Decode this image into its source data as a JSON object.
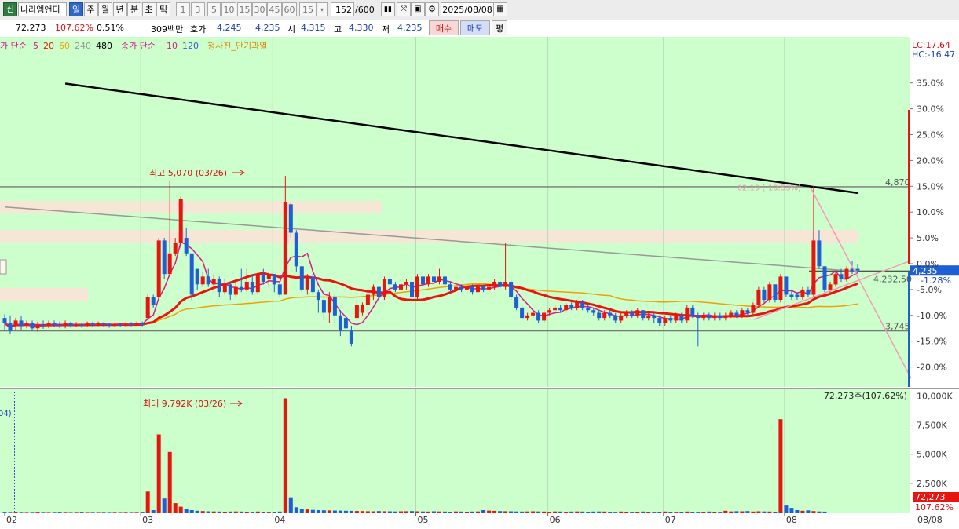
{
  "toolbar": {
    "market_badge": "신",
    "stock_name": "나라엠앤디",
    "periods": [
      "일",
      "주",
      "월",
      "년",
      "분",
      "초",
      "틱"
    ],
    "active_period": "일",
    "intervals": [
      "1",
      "3",
      "5",
      "10",
      "15",
      "30",
      "45",
      "60"
    ],
    "interval_value": "15",
    "count_value": "152",
    "count_total": "/600",
    "date": "2025/08/08"
  },
  "quote": {
    "volume": "72,273",
    "volume_ratio": "107.62%",
    "turnover": "0.51%",
    "amount": "309백만",
    "ask_label": "호가",
    "ask": "4,245",
    "bid": "4,235",
    "open_label": "시",
    "open": "4,315",
    "high_label": "고",
    "high": "4,330",
    "low_label": "저",
    "low": "4,235",
    "buy_label": "매수",
    "sell_label": "매도",
    "eval_label": "평"
  },
  "legend": {
    "ma_prefix": "가 단순",
    "ma_periods": [
      "5",
      "20",
      "60",
      "240",
      "480"
    ],
    "ma_colors": [
      "#d81b8a",
      "#e8140e",
      "#f0a000",
      "#999999",
      "#000000"
    ],
    "vol_ma": "종가 단순",
    "vol_periods": [
      "10",
      "120"
    ],
    "vol_colors": [
      "#d81b8a",
      "#3a5fd0"
    ],
    "signal": "청사진_단기과열",
    "signal_color": "#d98a00"
  },
  "right_top": {
    "lc": "LC:17.64",
    "hc": "HC:-16.47"
  },
  "price_annotations": {
    "max_label": "최고 5,070 (03/26)",
    "level_high": "4,870",
    "level_mid": "4,232,50",
    "level_low": "3,745",
    "current": "4,235",
    "current_pct": "-1.28%",
    "trend_note": "-62.19 (-10.53%)"
  },
  "volume_annotations": {
    "max_label": "최대 9,792K (03/26)",
    "total": "72,273주(107.62%)",
    "current": "72,273",
    "current_pct": "107.62%",
    "left_clip": "04)"
  },
  "chart_data": [
    {
      "type": "candlestick",
      "x": [
        "02",
        "03",
        "04",
        "05",
        "06",
        "07",
        "08"
      ],
      "yaxis_ticks": [
        "35.0%",
        "30.0%",
        "25.0%",
        "20.0%",
        "15.0%",
        "10.0%",
        "5.0%",
        "0.0%",
        "-5.0%",
        "-10.0%",
        "-15.0%",
        "-20.0%"
      ],
      "ylim": [
        -22,
        38
      ],
      "candles": [
        [
          -10.5,
          -11.5,
          -9.8,
          -13.0
        ],
        [
          -11.5,
          -13.0,
          -10.0,
          -13.5
        ],
        [
          -12.0,
          -11.0,
          -10.5,
          -13.0
        ],
        [
          -11.0,
          -12.0,
          -10.2,
          -12.8
        ],
        [
          -12.0,
          -11.5,
          -11.0,
          -12.5
        ],
        [
          -11.5,
          -12.5,
          -11.0,
          -13.0
        ],
        [
          -12.5,
          -11.8,
          -11.2,
          -13.2
        ],
        [
          -11.8,
          -12.0,
          -11.0,
          -12.6
        ],
        [
          -12.0,
          -11.5,
          -11.0,
          -12.5
        ],
        [
          -11.5,
          -11.8,
          -11.0,
          -12.2
        ],
        [
          -11.8,
          -12.0,
          -11.2,
          -12.5
        ],
        [
          -12.0,
          -11.5,
          -11.0,
          -12.5
        ],
        [
          -11.5,
          -12.0,
          -11.2,
          -12.4
        ],
        [
          -12.0,
          -11.8,
          -11.3,
          -12.3
        ],
        [
          -11.8,
          -12.0,
          -11.4,
          -12.4
        ],
        [
          -12.0,
          -11.5,
          -11.2,
          -12.3
        ],
        [
          -11.5,
          -11.8,
          -11.2,
          -12.2
        ],
        [
          -11.8,
          -11.5,
          -11.2,
          -12.1
        ],
        [
          -11.5,
          -11.8,
          -11.3,
          -12.2
        ],
        [
          -11.8,
          -12.0,
          -11.5,
          -12.4
        ],
        [
          -12.0,
          -11.7,
          -11.4,
          -12.3
        ],
        [
          -11.7,
          -11.9,
          -11.4,
          -12.2
        ],
        [
          -11.9,
          -11.6,
          -11.3,
          -12.2
        ],
        [
          -11.6,
          -11.8,
          -11.3,
          -12.1
        ],
        [
          -11.8,
          -11.5,
          -11.2,
          -12.0
        ],
        [
          -11.5,
          -11.8,
          -11.2,
          -12.1
        ],
        [
          -10.5,
          -6.5,
          -6.0,
          -11.0
        ],
        [
          -6.5,
          -8.0,
          -6.0,
          -8.5
        ],
        [
          -6.5,
          4.5,
          5.0,
          -7.0
        ],
        [
          4.5,
          -2.0,
          5.0,
          -3.0
        ],
        [
          -2.0,
          2.0,
          16.0,
          -2.5
        ],
        [
          2.0,
          4.0,
          5.0,
          1.5
        ],
        [
          4.0,
          12.5,
          13.0,
          3.0
        ],
        [
          5.0,
          2.0,
          7.0,
          1.5
        ],
        [
          2.0,
          -6.0,
          2.0,
          -7.0
        ],
        [
          -1.0,
          -4.0,
          -1.0,
          -5.0
        ],
        [
          -4.0,
          -2.5,
          -1.5,
          -4.5
        ],
        [
          -2.5,
          -4.0,
          -1.0,
          -4.5
        ],
        [
          -4.0,
          -3.0,
          -2.0,
          -5.0
        ],
        [
          -3.0,
          -5.5,
          -2.5,
          -6.5
        ],
        [
          -5.5,
          -4.0,
          -3.0,
          -6.0
        ],
        [
          -4.0,
          -6.0,
          -3.5,
          -7.0
        ],
        [
          -6.0,
          -4.5,
          -3.0,
          -6.5
        ],
        [
          -4.5,
          -5.0,
          -1.0,
          -5.5
        ],
        [
          -5.0,
          -3.5,
          -1.0,
          -5.5
        ],
        [
          -3.5,
          -5.5,
          -2.0,
          -6.0
        ],
        [
          -5.5,
          -2.0,
          -1.5,
          -6.0
        ],
        [
          -2.0,
          -3.5,
          -1.0,
          -4.0
        ],
        [
          -3.0,
          -2.0,
          -1.5,
          -4.5
        ],
        [
          -2.0,
          -4.0,
          -2.0,
          -5.5
        ],
        [
          -4.0,
          -6.0,
          -3.5,
          -6.5
        ],
        [
          -6.0,
          12.0,
          17.0,
          -6.0
        ],
        [
          11.5,
          6.0,
          12.0,
          5.0
        ],
        [
          6.0,
          -0.5,
          6.5,
          -1.5
        ],
        [
          -0.5,
          -5.0,
          -0.5,
          -5.5
        ],
        [
          -5.0,
          -2.5,
          -2.0,
          -6.0
        ],
        [
          -2.5,
          -5.5,
          -2.0,
          -6.0
        ],
        [
          -5.5,
          -7.0,
          -5.0,
          -9.5
        ],
        [
          -7.0,
          -9.5,
          -6.5,
          -11.0
        ],
        [
          -9.5,
          -6.5,
          -5.5,
          -11.5
        ],
        [
          -6.5,
          -10.0,
          -6.0,
          -11.5
        ],
        [
          -10.0,
          -13.0,
          -9.0,
          -14.0
        ],
        [
          -10.5,
          -12.5,
          -10.0,
          -13.0
        ],
        [
          -13.0,
          -15.5,
          -12.0,
          -16.0
        ],
        [
          -10.5,
          -8.0,
          -7.0,
          -11.0
        ],
        [
          -9.5,
          -8.0,
          -7.5,
          -10.0
        ],
        [
          -8.0,
          -6.0,
          -5.5,
          -9.5
        ],
        [
          -6.0,
          -4.5,
          -4.0,
          -7.0
        ],
        [
          -4.5,
          -6.5,
          -4.5,
          -7.0
        ],
        [
          -6.5,
          -3.0,
          -2.5,
          -7.0
        ],
        [
          -3.0,
          -4.0,
          -1.5,
          -5.0
        ],
        [
          -4.0,
          -5.0,
          -3.5,
          -5.5
        ],
        [
          -5.0,
          -4.0,
          -3.0,
          -5.5
        ],
        [
          -4.0,
          -3.5,
          -3.0,
          -5.0
        ],
        [
          -3.5,
          -6.5,
          -3.0,
          -7.0
        ],
        [
          -6.5,
          -2.5,
          -2.0,
          -7.0
        ],
        [
          -2.5,
          -4.0,
          -2.0,
          -4.5
        ],
        [
          -4.0,
          -2.5,
          -2.0,
          -4.5
        ],
        [
          -2.5,
          -3.5,
          -1.5,
          -4.0
        ],
        [
          -3.5,
          -2.5,
          -1.0,
          -4.0
        ],
        [
          -2.5,
          -4.0,
          -2.0,
          -5.0
        ],
        [
          -4.0,
          -5.0,
          -3.5,
          -5.5
        ],
        [
          -5.0,
          -4.5,
          -4.0,
          -5.5
        ],
        [
          -4.5,
          -5.0,
          -4.0,
          -5.5
        ],
        [
          -5.0,
          -4.5,
          -4.0,
          -6.0
        ],
        [
          -4.5,
          -5.5,
          -4.0,
          -6.0
        ],
        [
          -5.5,
          -4.5,
          -4.0,
          -6.0
        ],
        [
          -4.5,
          -5.0,
          -4.0,
          -5.5
        ],
        [
          -5.0,
          -4.5,
          -4.0,
          -5.5
        ],
        [
          -4.5,
          -3.5,
          -3.0,
          -5.0
        ],
        [
          -3.5,
          -4.5,
          -3.0,
          -5.0
        ],
        [
          -4.5,
          -3.5,
          4.0,
          -5.0
        ],
        [
          -3.5,
          -6.5,
          -3.0,
          -7.0
        ],
        [
          -6.5,
          -8.5,
          -6.0,
          -9.0
        ],
        [
          -8.5,
          -10.5,
          -8.0,
          -11.0
        ],
        [
          -10.5,
          -10.0,
          -9.5,
          -11.0
        ],
        [
          -10.0,
          -9.5,
          -9.0,
          -10.5
        ],
        [
          -9.5,
          -11.0,
          -9.0,
          -11.5
        ],
        [
          -11.0,
          -9.5,
          -9.0,
          -11.5
        ],
        [
          -9.5,
          -9.0,
          -8.5,
          -10.0
        ],
        [
          -9.0,
          -8.5,
          -8.0,
          -9.5
        ],
        [
          -8.5,
          -9.0,
          -8.0,
          -9.5
        ],
        [
          -9.0,
          -8.0,
          -7.5,
          -9.5
        ],
        [
          -8.0,
          -8.5,
          -7.5,
          -9.0
        ],
        [
          -8.5,
          -7.5,
          -7.0,
          -9.0
        ],
        [
          -7.5,
          -8.5,
          -7.0,
          -9.0
        ],
        [
          -8.5,
          -9.0,
          -8.0,
          -9.5
        ],
        [
          -9.0,
          -9.5,
          -8.5,
          -10.0
        ],
        [
          -9.5,
          -10.5,
          -9.0,
          -11.0
        ],
        [
          -10.5,
          -9.5,
          -9.0,
          -11.0
        ],
        [
          -9.5,
          -10.0,
          -9.0,
          -10.5
        ],
        [
          -10.0,
          -11.0,
          -9.5,
          -11.5
        ],
        [
          -11.0,
          -10.0,
          -9.5,
          -11.5
        ],
        [
          -10.0,
          -9.5,
          -9.0,
          -10.5
        ],
        [
          -9.5,
          -10.0,
          -9.0,
          -10.5
        ],
        [
          -10.0,
          -9.0,
          -8.5,
          -10.5
        ],
        [
          -9.0,
          -10.5,
          -9.0,
          -11.0
        ],
        [
          -10.5,
          -10.0,
          -9.5,
          -11.0
        ],
        [
          -10.0,
          -10.5,
          -9.5,
          -11.5
        ],
        [
          -10.5,
          -11.5,
          -10.0,
          -12.0
        ],
        [
          -11.5,
          -10.5,
          -10.0,
          -12.0
        ],
        [
          -10.5,
          -11.0,
          -10.0,
          -11.5
        ],
        [
          -11.0,
          -10.0,
          -9.5,
          -11.5
        ],
        [
          -10.0,
          -11.0,
          -9.5,
          -11.5
        ],
        [
          -11.0,
          -8.5,
          -8.0,
          -11.5
        ],
        [
          -8.5,
          -10.0,
          -8.0,
          -10.5
        ],
        [
          -10.0,
          -10.5,
          -9.5,
          -16.0
        ],
        [
          -10.5,
          -10.0,
          -9.5,
          -11.0
        ],
        [
          -10.0,
          -10.5,
          -9.5,
          -11.0
        ],
        [
          -10.5,
          -10.0,
          -9.5,
          -11.0
        ],
        [
          -10.0,
          -10.5,
          -9.5,
          -11.0
        ],
        [
          -10.5,
          -10.0,
          -9.5,
          -11.0
        ],
        [
          -10.0,
          -9.5,
          -9.0,
          -10.5
        ],
        [
          -9.5,
          -10.0,
          -9.0,
          -10.5
        ],
        [
          -10.0,
          -9.0,
          -8.5,
          -10.5
        ],
        [
          -9.0,
          -9.5,
          -8.5,
          -10.0
        ],
        [
          -9.5,
          -8.0,
          -7.5,
          -10.0
        ],
        [
          -8.0,
          -5.0,
          -4.5,
          -8.5
        ],
        [
          -5.0,
          -7.0,
          -4.5,
          -7.5
        ],
        [
          -7.0,
          -4.0,
          -3.5,
          -7.5
        ],
        [
          -4.0,
          -7.0,
          -4.0,
          -7.5
        ],
        [
          -7.0,
          -2.5,
          -2.0,
          -7.5
        ],
        [
          -2.5,
          -6.0,
          -2.5,
          -6.5
        ],
        [
          -6.0,
          -6.5,
          -5.0,
          -7.0
        ],
        [
          -6.0,
          -6.5,
          -5.5,
          -7.0
        ],
        [
          -6.5,
          -5.0,
          -4.5,
          -7.0
        ],
        [
          -5.0,
          -6.0,
          -4.5,
          -6.5
        ],
        [
          -6.0,
          4.5,
          15.0,
          -6.5
        ],
        [
          4.5,
          -0.5,
          6.5,
          -1.0
        ],
        [
          -0.5,
          -5.0,
          -0.5,
          -5.5
        ],
        [
          -5.0,
          -4.0,
          -3.5,
          -6.0
        ],
        [
          -4.0,
          -2.0,
          -1.5,
          -4.5
        ],
        [
          -2.0,
          -3.0,
          -1.0,
          -3.5
        ],
        [
          -3.0,
          -1.0,
          -0.5,
          -3.5
        ],
        [
          -1.0,
          -1.5,
          0.5,
          -2.0
        ],
        [
          -1.0,
          -1.28,
          0.0,
          -1.5
        ]
      ],
      "moving_averages": [
        {
          "period": "5",
          "color": "#d81b8a"
        },
        {
          "period": "20",
          "color": "#e8140e"
        },
        {
          "period": "60",
          "color": "#f0a000"
        },
        {
          "period": "240",
          "color": "#999999"
        },
        {
          "period": "480",
          "color": "#000000"
        }
      ]
    },
    {
      "type": "bar",
      "x": [
        "02",
        "03",
        "04",
        "05",
        "06",
        "07",
        "08"
      ],
      "yaxis_ticks": [
        "10,000K",
        "7,500K",
        "5,000K",
        "2,500K"
      ],
      "ylim": [
        0,
        10300
      ],
      "unit": "K",
      "values": [
        60,
        50,
        60,
        50,
        40,
        50,
        60,
        50,
        40,
        50,
        60,
        50,
        40,
        50,
        60,
        40,
        50,
        40,
        50,
        40,
        50,
        40,
        50,
        40,
        50,
        60,
        1800,
        200,
        6700,
        1200,
        5200,
        800,
        500,
        300,
        200,
        150,
        120,
        100,
        90,
        80,
        70,
        80,
        90,
        80,
        70,
        60,
        80,
        70,
        60,
        70,
        80,
        9792,
        1300,
        450,
        300,
        260,
        220,
        200,
        190,
        180,
        170,
        160,
        150,
        140,
        130,
        120,
        110,
        100,
        120,
        110,
        100,
        90,
        100,
        110,
        120,
        100,
        90,
        80,
        100,
        90,
        80,
        70,
        90,
        80,
        70,
        80,
        90,
        200,
        160,
        140,
        120,
        110,
        100,
        90,
        80,
        90,
        100,
        90,
        80,
        70,
        90,
        80,
        70,
        80,
        90,
        80,
        70,
        80,
        90,
        80,
        70,
        60,
        80,
        70,
        60,
        70,
        80,
        70,
        60,
        70,
        80,
        70,
        60,
        70,
        80,
        70,
        60,
        70,
        80,
        70,
        60,
        150,
        90,
        110,
        100,
        120,
        80,
        100,
        90,
        80,
        70,
        8000,
        600,
        400,
        200,
        150,
        180,
        120,
        90,
        72
      ]
    }
  ]
}
